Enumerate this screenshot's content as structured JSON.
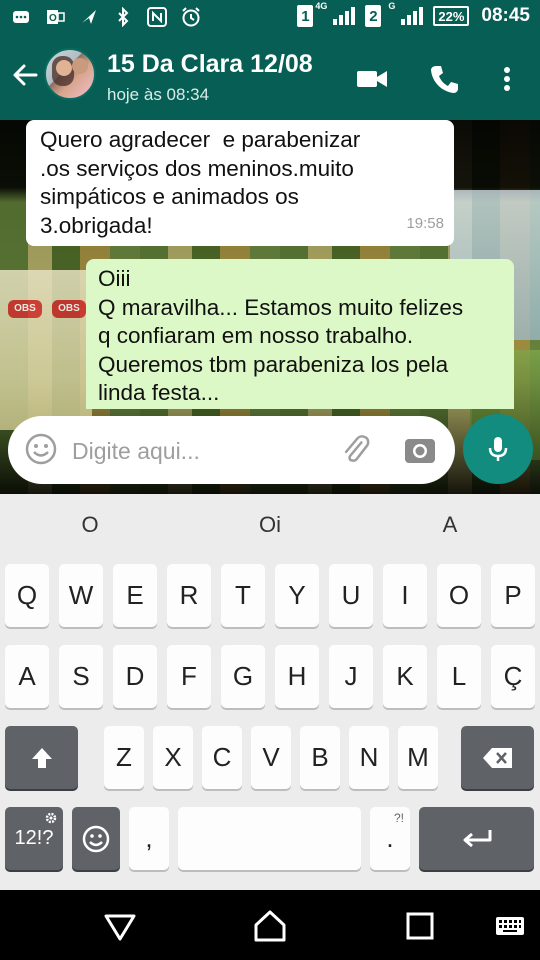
{
  "status_bar": {
    "icons": [
      "whatsapp-icon",
      "outlook-icon",
      "send-icon",
      "bluetooth-icon",
      "nfc-icon",
      "alarm-icon"
    ],
    "sim1": "1",
    "sim1_net": "4G",
    "sim2": "2",
    "sim2_net": "G",
    "battery": "22%",
    "time": "08:45"
  },
  "header": {
    "title": "15 Da Clara 12/08",
    "subtitle": "hoje às 08:34"
  },
  "messages": [
    {
      "direction": "incoming",
      "lines": [
        "Quero agradecer  e parabenizar",
        ".os serviços dos meninos.muito",
        "simpáticos e animados os",
        "3.obrigada!"
      ],
      "time": "19:58"
    },
    {
      "direction": "outgoing",
      "lines": [
        "Oiii",
        "Q maravilha... Estamos muito felizes",
        "q confiaram em nosso trabalho.",
        "Queremos tbm parabeniza los pela",
        "linda festa..."
      ]
    }
  ],
  "wallpaper_labels": [
    "OBS",
    "OBS"
  ],
  "composer": {
    "placeholder": "Digite aqui..."
  },
  "keyboard": {
    "suggestions": [
      "O",
      "Oi",
      "A"
    ],
    "row1": [
      "Q",
      "W",
      "E",
      "R",
      "T",
      "Y",
      "U",
      "I",
      "O",
      "P"
    ],
    "row2": [
      "A",
      "S",
      "D",
      "F",
      "G",
      "H",
      "J",
      "K",
      "L",
      "Ç"
    ],
    "row3": [
      "Z",
      "X",
      "C",
      "V",
      "B",
      "N",
      "M"
    ],
    "symbols_key": "12!?",
    "comma_key": ",",
    "period_key": ".",
    "period_sub": "?!"
  },
  "colors": {
    "header": "#075e54",
    "outgoing_bubble": "#dcf8c6",
    "mic_button": "#128c7e"
  }
}
